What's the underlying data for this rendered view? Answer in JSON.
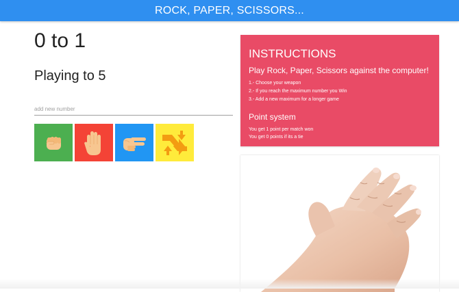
{
  "header": {
    "title": "ROCK, PAPER, SCISSORS..."
  },
  "score": {
    "text": "0 to 1"
  },
  "target": {
    "text": "Playing to 5"
  },
  "number_input": {
    "placeholder": "add new number",
    "value": ""
  },
  "weapons": [
    {
      "name": "rock",
      "icon": "fist-icon",
      "color": "#4caf50"
    },
    {
      "name": "paper",
      "icon": "open-hand-icon",
      "color": "#f44336"
    },
    {
      "name": "scissors",
      "icon": "victory-hand-icon",
      "color": "#2196f3"
    },
    {
      "name": "reset",
      "icon": "refresh-arrows-icon",
      "color": "#ffeb3b"
    }
  ],
  "instructions": {
    "title": "INSTRUCTIONS",
    "subtitle": "Play Rock, Paper, Scissors against the computer!",
    "steps": [
      "1.- Choose your weapon",
      "2.- If you reach the maximum number you Win",
      "3.- Add a new maximum for a longer game"
    ],
    "points_title": "Point system",
    "points": [
      "You get 1 point per match won",
      "You get 0 points if its a tie"
    ],
    "color": "#e94b66"
  },
  "computer_choice": {
    "icon": "paper-hand-photo"
  },
  "colors": {
    "accent": "#2f8ff0"
  }
}
